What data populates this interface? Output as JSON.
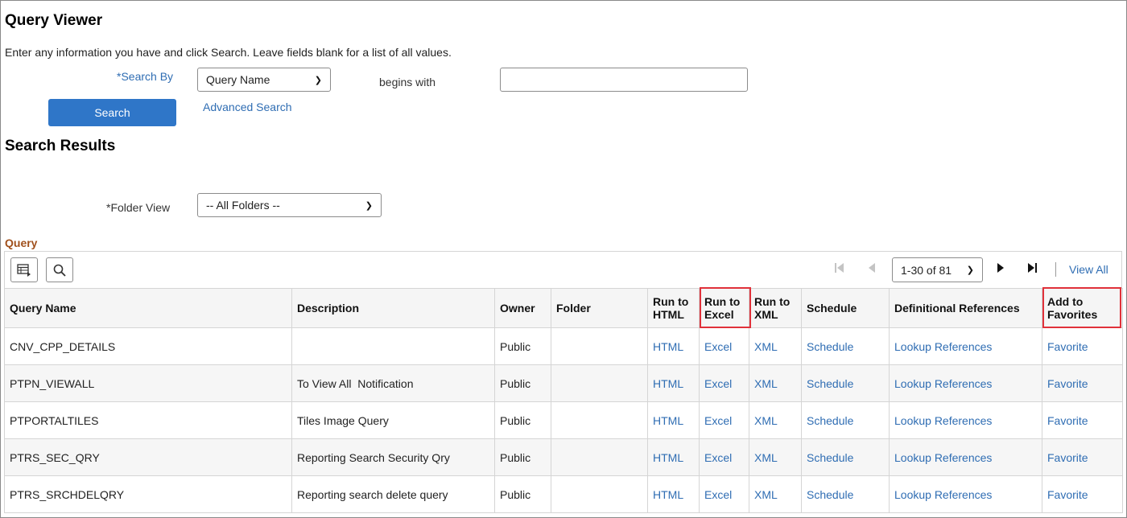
{
  "page": {
    "title": "Query Viewer",
    "instructions": "Enter any information you have and click Search. Leave fields blank for a list of all values."
  },
  "search": {
    "search_by_label": "*Search By",
    "search_by_value": "Query Name",
    "operator": "begins with",
    "input_value": "",
    "search_button": "Search",
    "advanced_link": "Advanced Search"
  },
  "results": {
    "title": "Search Results",
    "folder_view_label": "*Folder View",
    "folder_view_value": "-- All Folders --"
  },
  "grid": {
    "title": "Query",
    "pager_range": "1-30 of 81",
    "view_all": "View All",
    "columns": {
      "query_name": "Query Name",
      "description": "Description",
      "owner": "Owner",
      "folder": "Folder",
      "run_html_1": "Run to",
      "run_html_2": "HTML",
      "run_excel_1": "Run to",
      "run_excel_2": "Excel",
      "run_xml_1": "Run to",
      "run_xml_2": "XML",
      "schedule": "Schedule",
      "def_refs": "Definitional References",
      "fav_1": "Add to",
      "fav_2": "Favorites"
    },
    "rows": [
      {
        "name": "CNV_CPP_DETAILS",
        "description": "",
        "owner": "Public",
        "folder": "",
        "html": "HTML",
        "excel": "Excel",
        "xml": "XML",
        "schedule": "Schedule",
        "refs": "Lookup References",
        "favorite": "Favorite"
      },
      {
        "name": "PTPN_VIEWALL",
        "description": "To View All  Notification",
        "owner": "Public",
        "folder": "",
        "html": "HTML",
        "excel": "Excel",
        "xml": "XML",
        "schedule": "Schedule",
        "refs": "Lookup References",
        "favorite": "Favorite"
      },
      {
        "name": "PTPORTALTILES",
        "description": "Tiles Image Query",
        "owner": "Public",
        "folder": "",
        "html": "HTML",
        "excel": "Excel",
        "xml": "XML",
        "schedule": "Schedule",
        "refs": "Lookup References",
        "favorite": "Favorite"
      },
      {
        "name": "PTRS_SEC_QRY",
        "description": "Reporting Search Security Qry",
        "owner": "Public",
        "folder": "",
        "html": "HTML",
        "excel": "Excel",
        "xml": "XML",
        "schedule": "Schedule",
        "refs": "Lookup References",
        "favorite": "Favorite"
      },
      {
        "name": "PTRS_SRCHDELQRY",
        "description": "Reporting search delete query",
        "owner": "Public",
        "folder": "",
        "html": "HTML",
        "excel": "Excel",
        "xml": "XML",
        "schedule": "Schedule",
        "refs": "Lookup References",
        "favorite": "Favorite"
      }
    ]
  }
}
